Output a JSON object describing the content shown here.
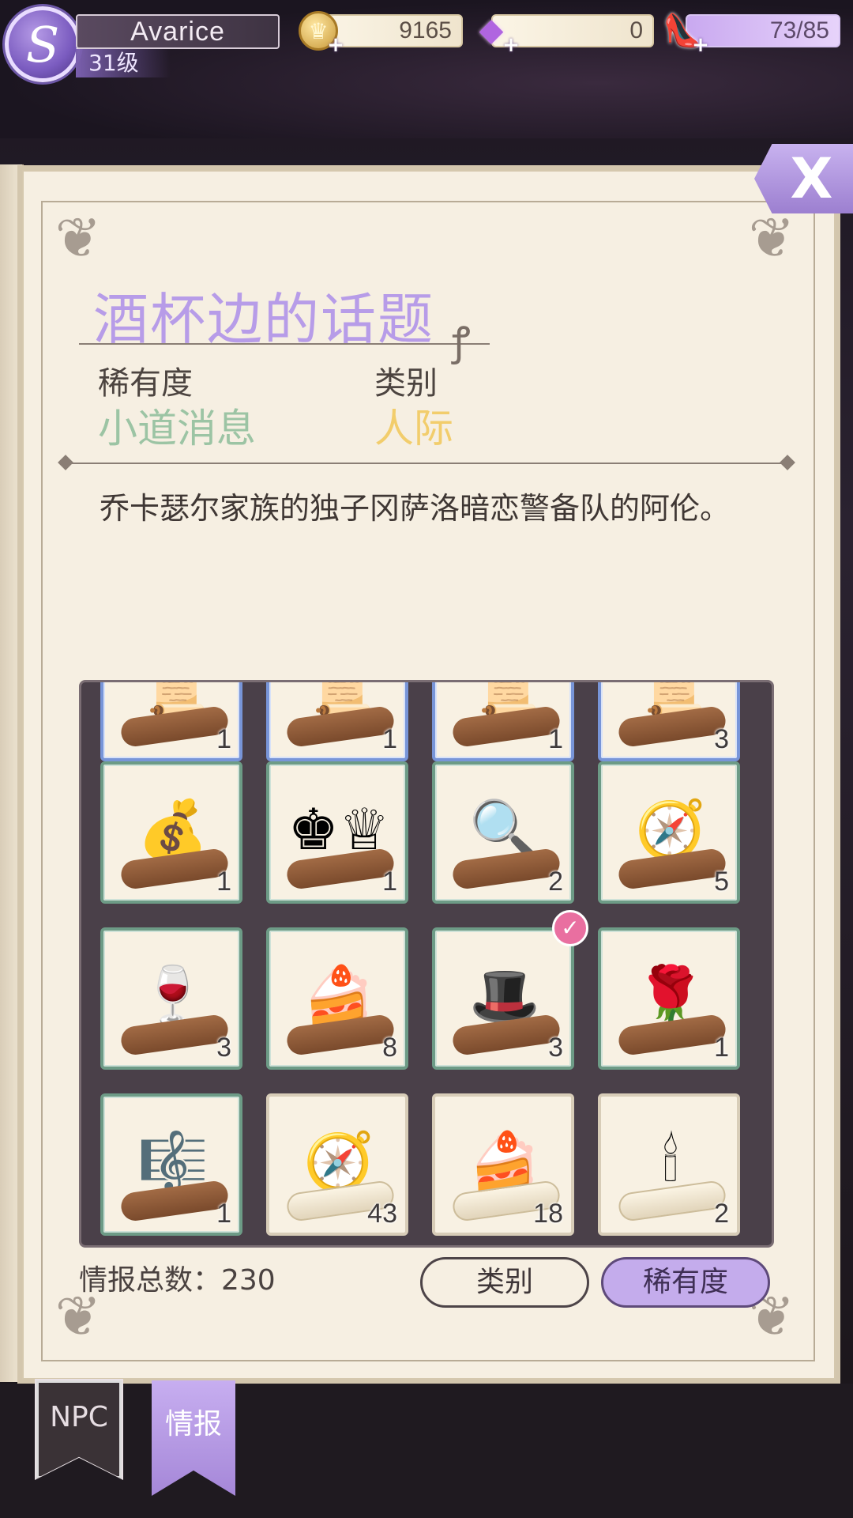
{
  "player": {
    "name": "Avarice",
    "level": "31级",
    "avatar_glyph": "S"
  },
  "resources": {
    "gold": "9165",
    "diamond": "0",
    "stamina": "73/85"
  },
  "detail": {
    "title": "酒杯边的话题",
    "rarity_label": "稀有度",
    "rarity_value": "小道消息",
    "category_label": "类别",
    "category_value": "人际",
    "description": "乔卡瑟尔家族的独子冈萨洛暗恋警备队的阿伦。",
    "rarity_color": "#9cc4a4",
    "category_color": "#f2cd6c"
  },
  "grid": {
    "items": [
      {
        "icon": "scroll-icon",
        "glyph": "📜",
        "count": "1",
        "style": "blue"
      },
      {
        "icon": "scroll-icon",
        "glyph": "📜",
        "count": "1",
        "style": "blue"
      },
      {
        "icon": "scroll-icon",
        "glyph": "📜",
        "count": "1",
        "style": "blue"
      },
      {
        "icon": "scroll-icon",
        "glyph": "📜",
        "count": "3",
        "style": "blue"
      },
      {
        "icon": "money-bag-icon",
        "glyph": "💰",
        "count": "1",
        "style": "green"
      },
      {
        "icon": "chess-pieces-icon",
        "glyph": "♚♕",
        "count": "1",
        "style": "green"
      },
      {
        "icon": "magnifying-glass-icon",
        "glyph": "🔍",
        "count": "2",
        "style": "green"
      },
      {
        "icon": "compass-icon",
        "glyph": "🧭",
        "count": "5",
        "style": "green"
      },
      {
        "icon": "wine-bottle-icon",
        "glyph": "🍷",
        "count": "3",
        "style": "green"
      },
      {
        "icon": "cake-icon",
        "glyph": "🍰",
        "count": "8",
        "style": "green"
      },
      {
        "icon": "top-hat-icon",
        "glyph": "🎩",
        "count": "3",
        "style": "green",
        "checked": true
      },
      {
        "icon": "flower-vase-icon",
        "glyph": "🌹",
        "count": "1",
        "style": "green"
      },
      {
        "icon": "harp-icon",
        "glyph": "🎼",
        "count": "1",
        "style": "green"
      },
      {
        "icon": "compass-icon",
        "glyph": "🧭",
        "count": "43",
        "style": "plain"
      },
      {
        "icon": "cake-icon",
        "glyph": "🍰",
        "count": "18",
        "style": "plain"
      },
      {
        "icon": "candelabra-icon",
        "glyph": "🕯",
        "count": "2",
        "style": "plain"
      }
    ]
  },
  "footer": {
    "total_label": "情报总数：230",
    "category_button": "类别",
    "rarity_button": "稀有度"
  },
  "tabs": {
    "npc": "NPC",
    "info": "情报"
  },
  "close_glyph": "X"
}
